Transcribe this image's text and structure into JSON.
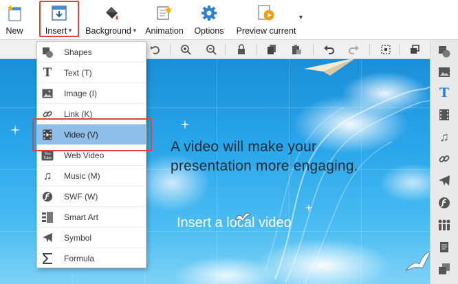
{
  "ribbon": {
    "new_label": "New",
    "insert_label": "Insert",
    "background_label": "Background",
    "animation_label": "Animation",
    "options_label": "Options",
    "preview_label": "Preview current"
  },
  "menu": {
    "items": [
      {
        "label": "Shapes",
        "icon": "shapes-icon"
      },
      {
        "label": "Text (T)",
        "icon": "text-icon"
      },
      {
        "label": "Image (I)",
        "icon": "image-icon"
      },
      {
        "label": "Link (K)",
        "icon": "link-icon"
      },
      {
        "label": "Video (V)",
        "icon": "video-icon",
        "selected": true
      },
      {
        "label": "Web Video",
        "icon": "youtube-icon"
      },
      {
        "label": "Music (M)",
        "icon": "music-icon"
      },
      {
        "label": "SWF (W)",
        "icon": "flash-icon"
      },
      {
        "label": "Smart Art",
        "icon": "smart-art-icon"
      },
      {
        "label": "Symbol",
        "icon": "airplane-icon"
      },
      {
        "label": "Formula",
        "icon": "sigma-icon"
      }
    ]
  },
  "canvas": {
    "headline_line1": "A video will make your",
    "headline_line2": "presentation more engaging.",
    "subtext": "Insert a local video"
  },
  "colors": {
    "highlight_red": "#e2413c",
    "selected_blue": "#8fbfe8",
    "sky_blue": "#2aa6ea"
  }
}
